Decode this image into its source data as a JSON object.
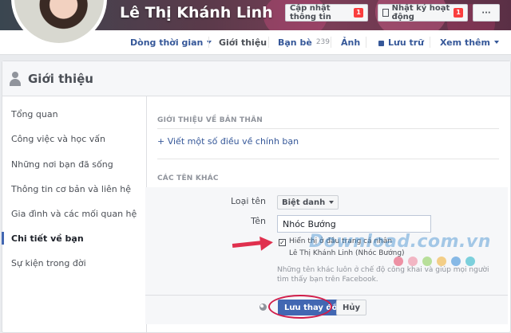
{
  "profile": {
    "name": "Lê Thị Khánh Linh",
    "update_info_label": "Cập nhật thông tin",
    "update_info_badge": "1",
    "activity_log_label": "Nhật ký hoạt động",
    "activity_log_badge": "1",
    "more_label": "···"
  },
  "nav": {
    "timeline": "Dòng thời gian",
    "about": "Giới thiệu",
    "friends": "Bạn bè",
    "friends_count": "239",
    "photos": "Ảnh",
    "archive": "Lưu trữ",
    "see_more": "Xem thêm"
  },
  "panel": {
    "title": "Giới thiệu"
  },
  "sidebar": {
    "items": [
      {
        "label": "Tổng quan"
      },
      {
        "label": "Công việc và học vấn"
      },
      {
        "label": "Những nơi bạn đã sống"
      },
      {
        "label": "Thông tin cơ bản và liên hệ"
      },
      {
        "label": "Gia đình và các mối quan hệ"
      },
      {
        "label": "Chi tiết về bạn"
      },
      {
        "label": "Sự kiện trong đời"
      }
    ]
  },
  "main": {
    "about_you_title": "GIỚI THIỆU VỀ BẢN THÂN",
    "add_about_link": "+ Viết một số điều về chính bạn",
    "other_names_title": "CÁC TÊN KHÁC",
    "name_type_label": "Loại tên",
    "name_type_value": "Biệt danh",
    "name_label": "Tên",
    "name_value": "Nhóc Bướng",
    "show_on_profile_label": "Hiển thị ở đầu trang cá nhân",
    "show_on_profile_preview": "Lê Thị Khánh Linh (Nhóc Bướng)",
    "checkbox_mark": "✓",
    "privacy_note": "Những tên khác luôn ở chế độ công khai và giúp mọi người tìm thấy bạn trên Facebook.",
    "save_label": "Lưu thay đổi",
    "cancel_label": "Hủy"
  },
  "watermark": {
    "text": "Download.com.vn",
    "dot_colors": [
      "#e84d6b",
      "#f08aa0",
      "#8fcf5a",
      "#f2b23a",
      "#3d8fd8",
      "#2bb5c8"
    ]
  },
  "colors": {
    "link": "#365899",
    "primary_button": "#4267b2",
    "annotation": "#e0304e"
  }
}
